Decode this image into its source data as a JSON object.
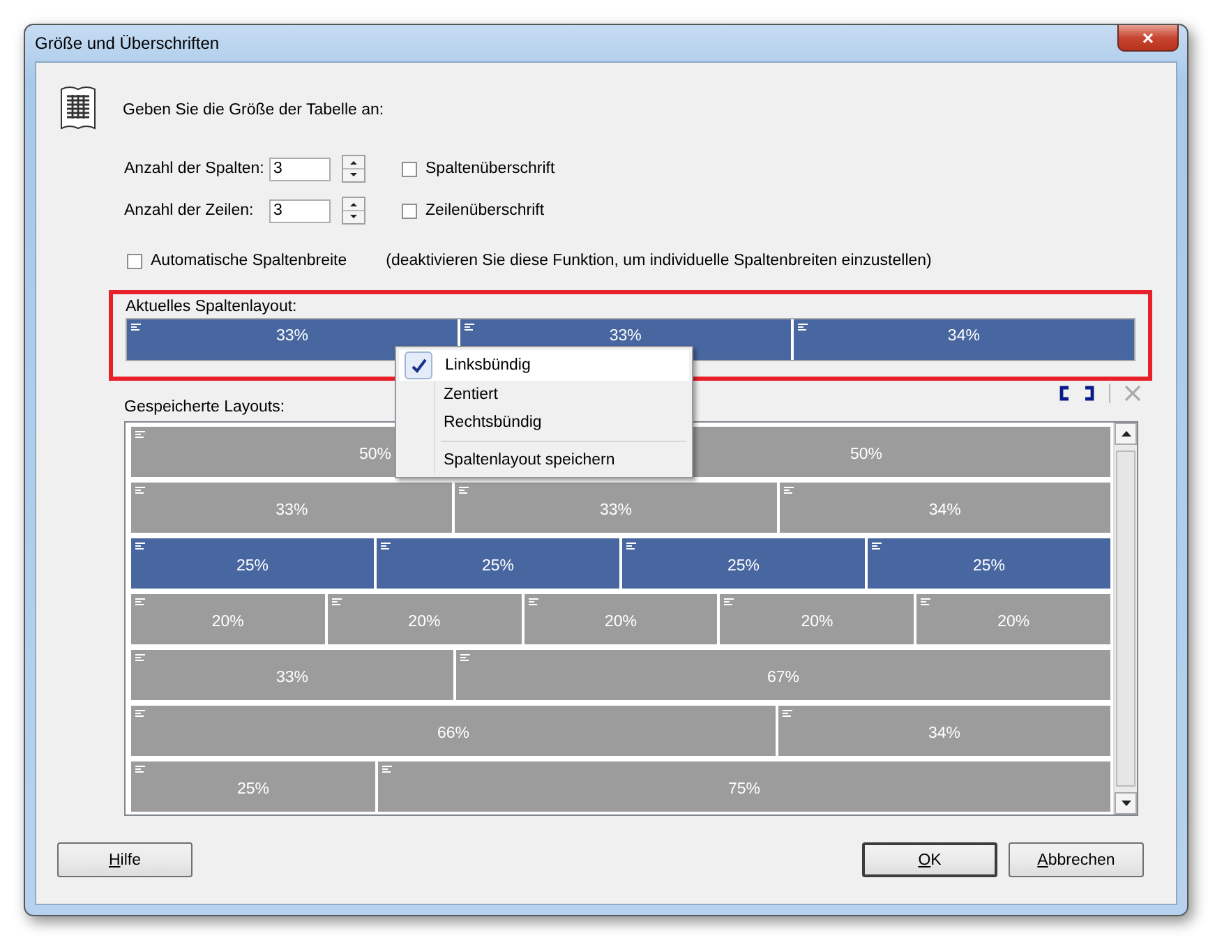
{
  "window": {
    "title": "Größe und Überschriften",
    "close": "×"
  },
  "intro": "Geben Sie die Größe der Tabelle an:",
  "size_fields": [
    {
      "label": "Anzahl der Spalten:",
      "value": "3",
      "checkbox": {
        "label": "Spaltenüberschrift",
        "checked": false
      }
    },
    {
      "label": "Anzahl der Zeilen:",
      "value": "3",
      "checkbox": {
        "label": "Zeilenüberschrift",
        "checked": false
      }
    }
  ],
  "auto_width": {
    "label": "Automatische Spaltenbreite",
    "checked": false,
    "note": "(deaktivieren Sie diese Funktion, um individuelle Spaltenbreiten einzustellen)"
  },
  "current_layout": {
    "label": "Aktuelles Spaltenlayout:",
    "columns": [
      "33%",
      "33%",
      "34%"
    ]
  },
  "saved_layouts": {
    "label": "Gespeicherte Layouts:",
    "rows": [
      {
        "columns": [
          "50%",
          "50%"
        ],
        "selected": false
      },
      {
        "columns": [
          "33%",
          "33%",
          "34%"
        ],
        "selected": false
      },
      {
        "columns": [
          "25%",
          "25%",
          "25%",
          "25%"
        ],
        "selected": true
      },
      {
        "columns": [
          "20%",
          "20%",
          "20%",
          "20%",
          "20%"
        ],
        "selected": false
      },
      {
        "columns": [
          "33%",
          "67%"
        ],
        "selected": false
      },
      {
        "columns": [
          "66%",
          "34%"
        ],
        "selected": false
      },
      {
        "columns": [
          "25%",
          "75%"
        ],
        "selected": false
      }
    ]
  },
  "context_menu": [
    {
      "kind": "item",
      "label": "Linksbündig",
      "checked": true
    },
    {
      "kind": "item",
      "label": "Zentiert",
      "checked": false
    },
    {
      "kind": "item",
      "label": "Rechtsbündig",
      "checked": false
    },
    {
      "kind": "separator"
    },
    {
      "kind": "item",
      "label": "Spaltenlayout speichern",
      "checked": false
    }
  ],
  "buttons": {
    "left": [
      {
        "label": "Hilfe",
        "default": false
      }
    ],
    "right": [
      {
        "label": "OK",
        "default": true
      },
      {
        "label": "Abbrechen",
        "default": false
      }
    ]
  }
}
